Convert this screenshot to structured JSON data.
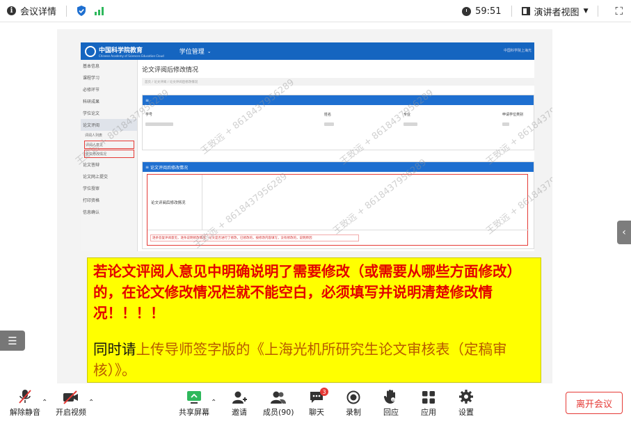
{
  "topbar": {
    "meeting_details": "会议详情",
    "timer": "59:51",
    "view_mode": "演讲者视图"
  },
  "portal": {
    "logo_text": "中国科学院教育",
    "logo_sub": "Chinese Academy of Sciences Education Cloud",
    "nav_menu": "学位管理",
    "header_right": "中国科学院上海光",
    "sidebar_items": [
      "基本信息",
      "课程学习",
      "必修环节",
      "科研成果",
      "学位论文",
      "论文评阅"
    ],
    "sidebar_subitems": [
      "评阅人列表",
      "评阅人意见",
      "论文修改情况"
    ],
    "sidebar_items_after": [
      "论文答辩",
      "论文网上提交",
      "学位授审",
      "打印资格",
      "信息确认"
    ],
    "page_title": "论文评阅后修改情况",
    "breadcrumb": "首页 / 论文评阅 / 论文评阅后修改情况",
    "table_headers": [
      "学号",
      "姓名",
      "专业",
      "申请学位类别"
    ],
    "panel2_title": "论文评阅后修改情况",
    "field_label": "论文评阅后修改情况",
    "hint_text": "逐条答复评阅意见，逐条说明修改情况：论文是否进行了修改，已修改的，按修改内容填写，没有修改的，说明原因"
  },
  "watermark": "王致远 + 8618437956289",
  "notice": {
    "red_text": "若论文评阅人意见中明确说明了需要修改（或需要从哪些方面修改）的，在论文修改情况栏就不能空白，必须填写并说明清楚修改情况！！！！",
    "part1": "同时请",
    "part2": "上传导师签字版的《上海光机所研究生论文审核表（定稿审核）》。"
  },
  "toolbar": {
    "mute": "解除静音",
    "video": "开启视频",
    "share": "共享屏幕",
    "invite": "邀请",
    "members": "成员(90)",
    "chat": "聊天",
    "chat_badge": "3",
    "record": "录制",
    "react": "回应",
    "apps": "应用",
    "settings": "设置",
    "leave": "离开会议"
  },
  "colors": {
    "accent_blue": "#1565c0",
    "notice_yellow": "#ffff00",
    "notice_red": "#e30000",
    "leave_red": "#e53935",
    "signal_green": "#2eb85c"
  }
}
